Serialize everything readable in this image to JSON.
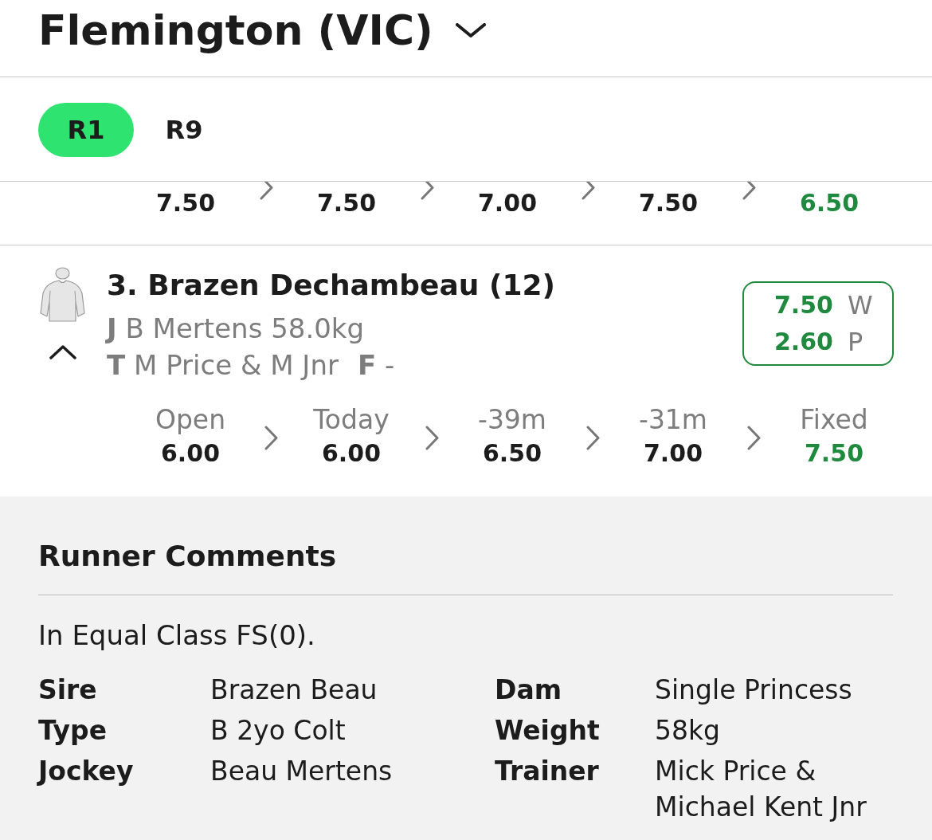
{
  "header": {
    "venue": "Flemington (VIC)"
  },
  "race_tabs": [
    {
      "label": "R1",
      "selected": true
    },
    {
      "label": "R9",
      "selected": false
    }
  ],
  "previous_runner": {
    "prices": [
      {
        "value": "7.50",
        "kind": "history"
      },
      {
        "value": "7.50",
        "kind": "history"
      },
      {
        "value": "7.00",
        "kind": "history"
      },
      {
        "value": "7.50",
        "kind": "history"
      },
      {
        "value": "6.50",
        "kind": "fixed"
      }
    ]
  },
  "runner": {
    "name": "3. Brazen Dechambeau (12)",
    "expanded": true,
    "jockey": {
      "label": "J",
      "value": "B Mertens 58.0kg"
    },
    "trainer": {
      "label": "T",
      "value": "M Price & M Jnr"
    },
    "form": {
      "label": "F",
      "value": "-"
    },
    "odds": [
      {
        "price": "7.50",
        "bet_type": "W"
      },
      {
        "price": "2.60",
        "bet_type": "P"
      }
    ],
    "price_history": [
      {
        "label": "Open",
        "value": "6.00",
        "kind": "history"
      },
      {
        "label": "Today",
        "value": "6.00",
        "kind": "history"
      },
      {
        "label": "-39m",
        "value": "6.50",
        "kind": "history"
      },
      {
        "label": "-31m",
        "value": "7.00",
        "kind": "history"
      },
      {
        "label": "Fixed",
        "value": "7.50",
        "kind": "fixed"
      }
    ]
  },
  "runner_comments": {
    "title": "Runner Comments",
    "summary": "In Equal Class FS(0).",
    "details": [
      {
        "label": "Sire",
        "value": "Brazen Beau"
      },
      {
        "label": "Dam",
        "value": "Single Princess"
      },
      {
        "label": "Type",
        "value": "B 2yo Colt"
      },
      {
        "label": "Weight",
        "value": "58kg"
      },
      {
        "label": "Jockey",
        "value": "Beau Mertens"
      },
      {
        "label": "Trainer",
        "value": "Mick Price & Michael Kent Jnr"
      }
    ]
  }
}
